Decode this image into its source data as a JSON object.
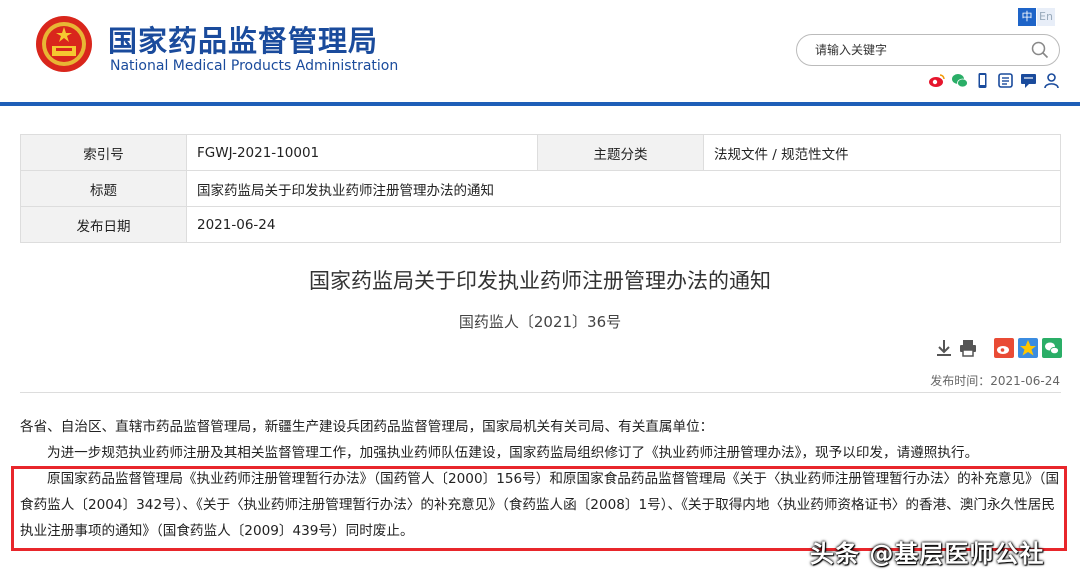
{
  "header": {
    "site_name_cn": "国家药品监督管理局",
    "site_name_en": "National Medical Products Administration",
    "lang_cn": "中",
    "lang_en": "En",
    "search_placeholder": "请输入关键字",
    "social_icons": [
      "weibo-icon",
      "wechat-icon",
      "mobile-icon",
      "app-icon",
      "message-icon",
      "user-icon"
    ],
    "brand_color": "#1a4b9c"
  },
  "meta": {
    "index_label": "索引号",
    "index_value": "FGWJ-2021-10001",
    "topic_label": "主题分类",
    "topic_value": "法规文件 / 规范性文件",
    "title_label": "标题",
    "title_value": "国家药监局关于印发执业药师注册管理办法的通知",
    "date_label": "发布日期",
    "date_value": "2021-06-24"
  },
  "doc": {
    "title": "国家药监局关于印发执业药师注册管理办法的通知",
    "number": "国药监人〔2021〕36号",
    "pubdate_label": "发布时间：",
    "pubdate_value": "2021-06-24",
    "para1": "各省、自治区、直辖市药品监督管理局，新疆生产建设兵团药品监督管理局，国家局机关有关司局、有关直属单位：",
    "para2": "为进一步规范执业药师注册及其相关监督管理工作，加强执业药师队伍建设，国家药监局组织修订了《执业药师注册管理办法》，现予以印发，请遵照执行。",
    "para3": "原国家药品监督管理局《执业药师注册管理暂行办法》（国药管人〔2000〕156号）和原国家食品药品监督管理局《关于〈执业药师注册管理暂行办法〉的补充意见》（国食药监人〔2004〕342号）、《关于〈执业药师注册管理暂行办法〉的补充意见》（食药监人函〔2008〕1号）、《关于取得内地〈执业药师资格证书〉的香港、澳门永久性居民执业注册事项的通知》（国食药监人〔2009〕439号）同时废止。"
  },
  "watermark": "头条 @基层医师公社",
  "highlight_color": "#e8262b"
}
